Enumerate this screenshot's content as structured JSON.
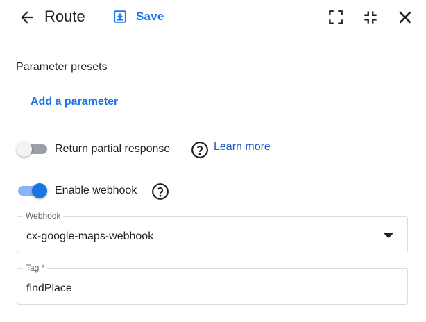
{
  "header": {
    "title": "Route",
    "save_label": "Save",
    "icons": [
      "back-arrow-icon",
      "save-icon",
      "expand-icon",
      "collapse-icon",
      "close-icon"
    ]
  },
  "body": {
    "section_title": "Parameter presets",
    "add_parameter_label": "Add a parameter",
    "partial_response": {
      "label": "Return partial response",
      "enabled": false,
      "learn_more": "Learn more"
    },
    "webhook_toggle": {
      "label": "Enable webhook",
      "enabled": true
    },
    "webhook_field": {
      "label": "Webhook",
      "value": "cx-google-maps-webhook"
    },
    "tag_field": {
      "label": "Tag *",
      "value": "findPlace"
    }
  },
  "colors": {
    "accent": "#1a73e8",
    "toggle_track_on": "#8ab4f8",
    "toggle_track_off": "#9aa0a6"
  }
}
